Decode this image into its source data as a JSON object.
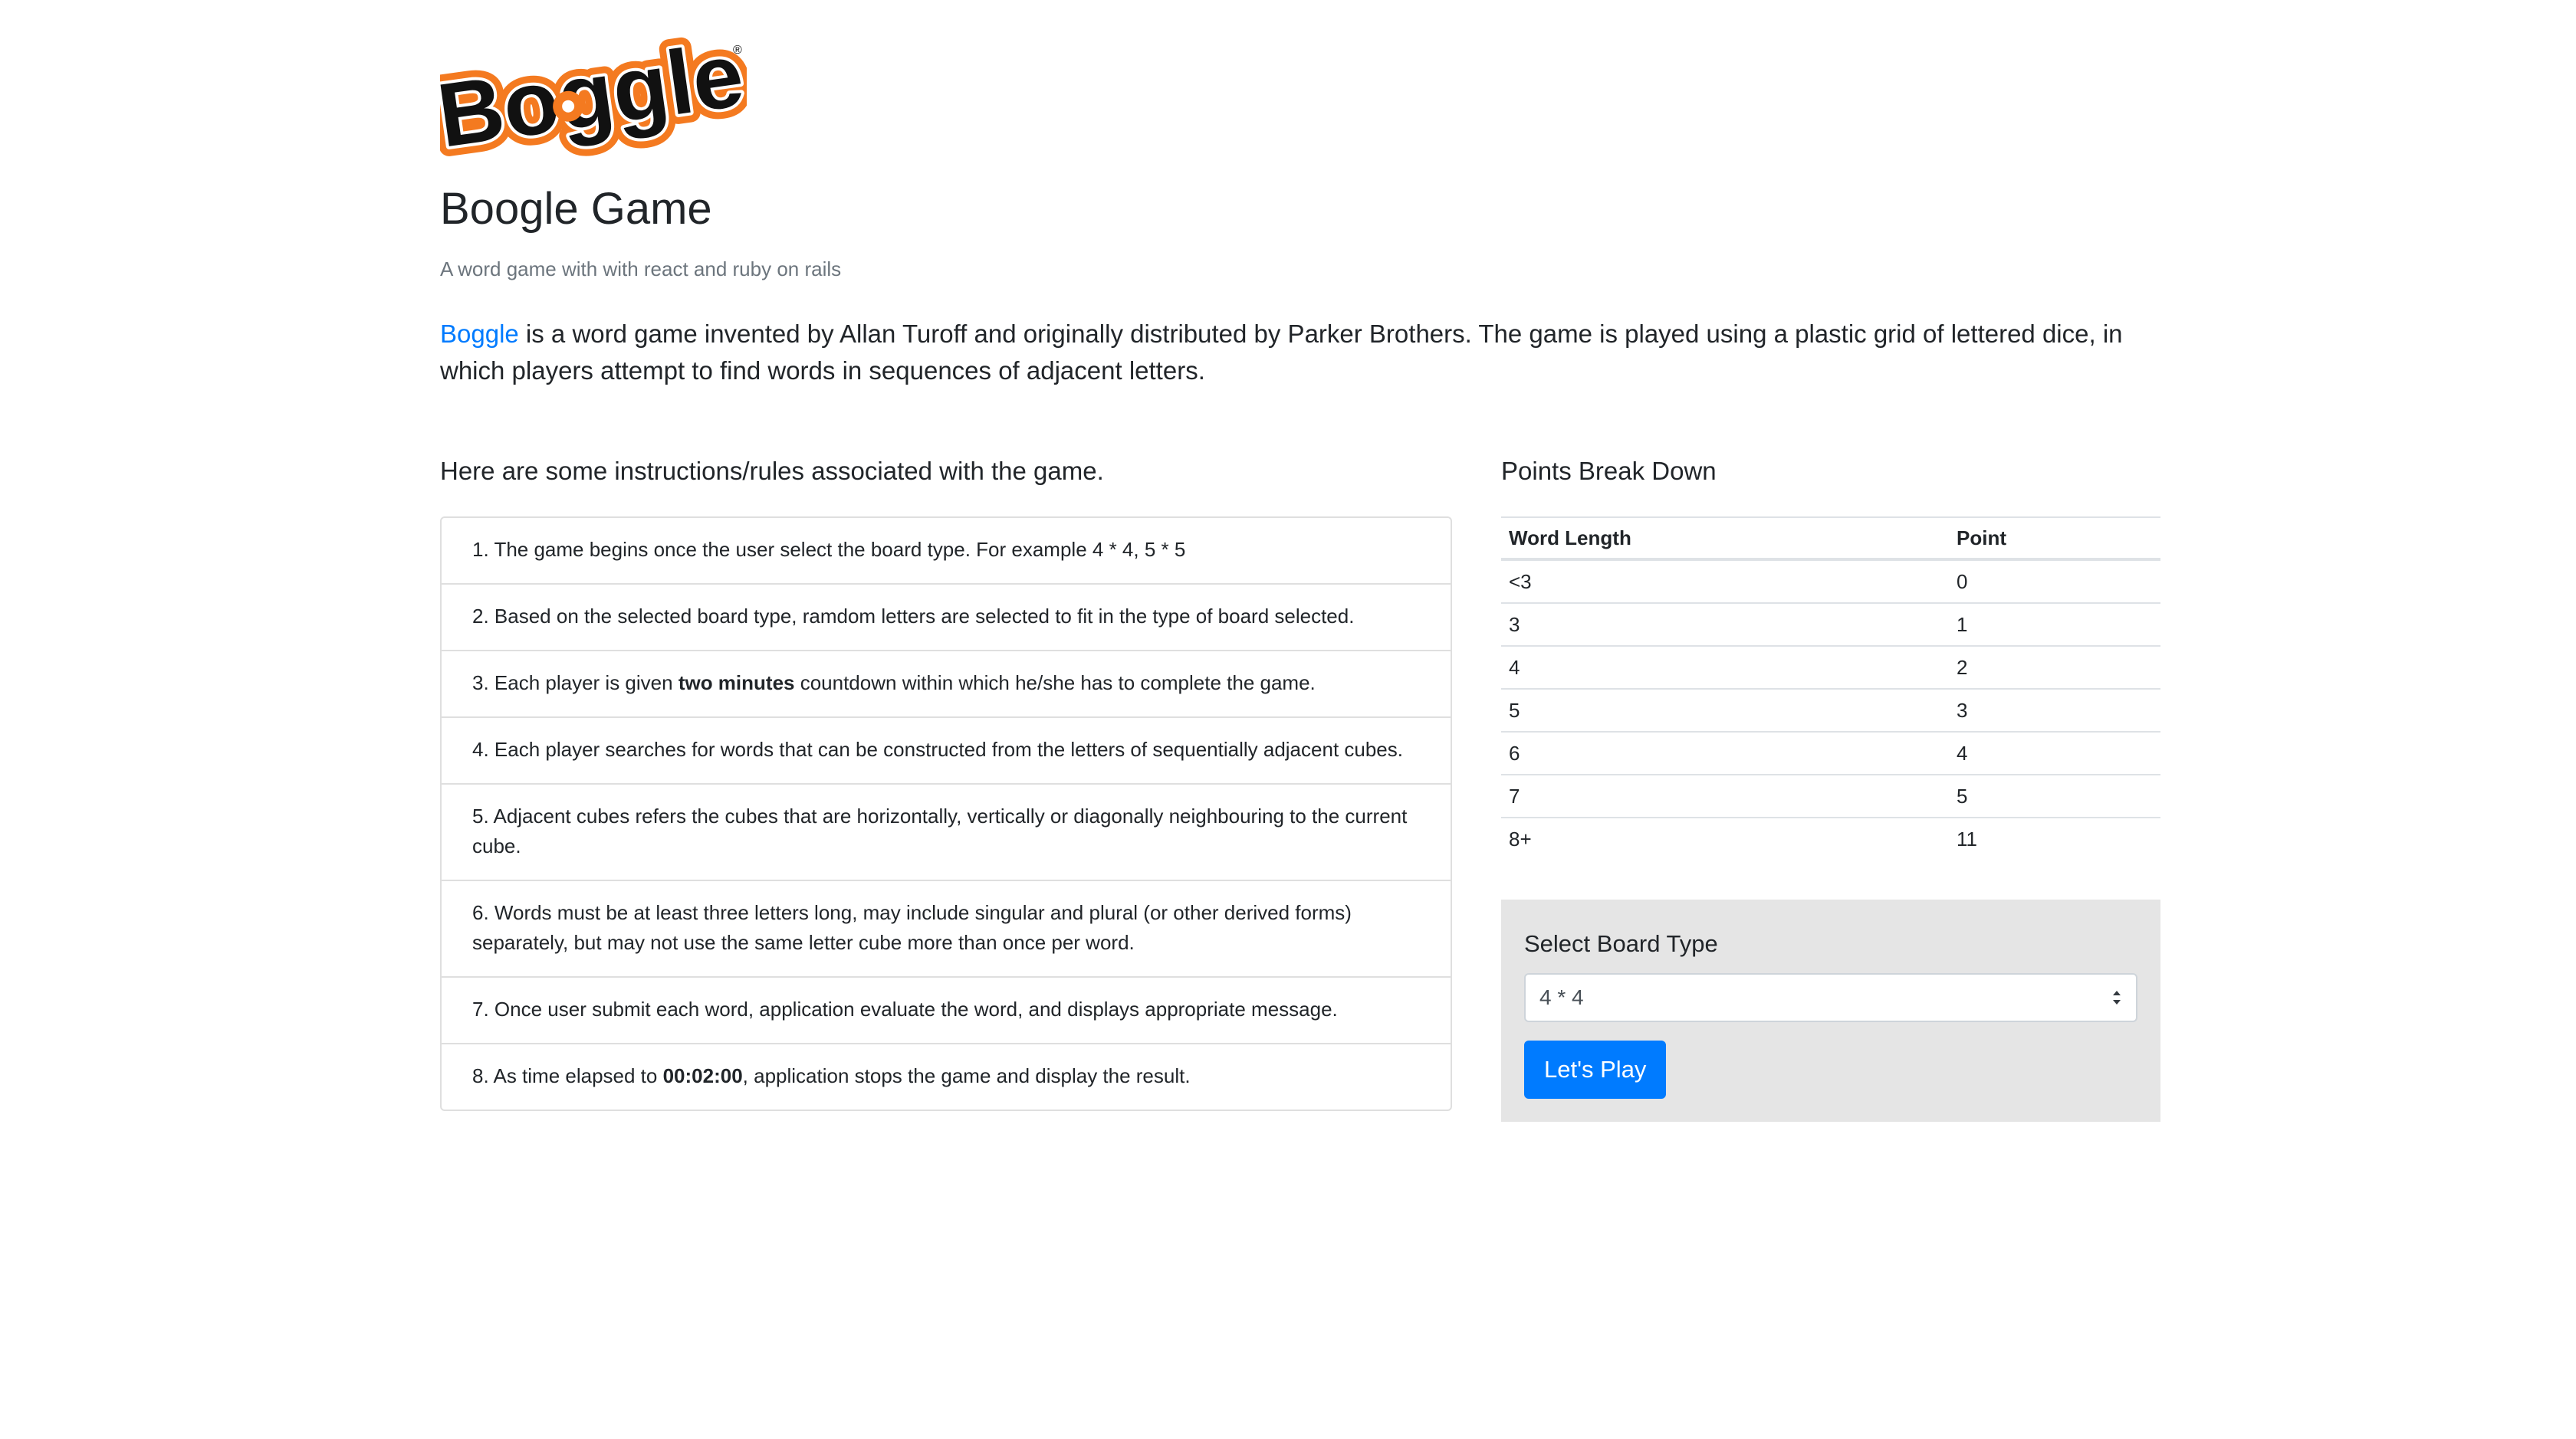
{
  "logo": {
    "text": "Boggle",
    "registered": "®"
  },
  "header": {
    "title": "Boogle Game",
    "subtitle": "A word game with with react and ruby on rails"
  },
  "intro": {
    "link_text": "Boggle",
    "text": " is a word game invented by Allan Turoff and originally distributed by Parker Brothers. The game is played using a plastic grid of lettered dice, in which players attempt to find words in sequences of adjacent letters."
  },
  "rules": {
    "heading": "Here are some instructions/rules associated with the game.",
    "items": [
      {
        "text": "1. The game begins once the user select the board type. For example 4 * 4, 5 * 5"
      },
      {
        "text": "2. Based on the selected board type, ramdom letters are selected to fit in the type of board selected."
      },
      {
        "pre": "3. Each player is given ",
        "bold": "two minutes",
        "post": " countdown within which he/she has to complete the game."
      },
      {
        "text": "4. Each player searches for words that can be constructed from the letters of sequentially adjacent cubes."
      },
      {
        "text": "5. Adjacent cubes refers the cubes that are horizontally, vertically or diagonally neighbouring to the current cube."
      },
      {
        "text": "6. Words must be at least three letters long, may include singular and plural (or other derived forms) separately, but may not use the same letter cube more than once per word."
      },
      {
        "text": "7. Once user submit each word, application evaluate the word, and displays appropriate message."
      },
      {
        "pre": "8. As time elapsed to ",
        "bold": "00:02:00",
        "post": ", application stops the game and display the result."
      }
    ]
  },
  "points": {
    "heading": "Points Break Down",
    "col_length": "Word Length",
    "col_point": "Point",
    "rows": [
      {
        "length": "<3",
        "point": "0"
      },
      {
        "length": "3",
        "point": "1"
      },
      {
        "length": "4",
        "point": "2"
      },
      {
        "length": "5",
        "point": "3"
      },
      {
        "length": "6",
        "point": "4"
      },
      {
        "length": "7",
        "point": "5"
      },
      {
        "length": "8+",
        "point": "11"
      }
    ]
  },
  "board": {
    "label": "Select Board Type",
    "selected": "4 * 4",
    "button": "Let's Play"
  },
  "colors": {
    "link": "#007bff",
    "button": "#007bff",
    "logo_orange": "#f47a20",
    "panel_bg": "#e5e5e5"
  }
}
